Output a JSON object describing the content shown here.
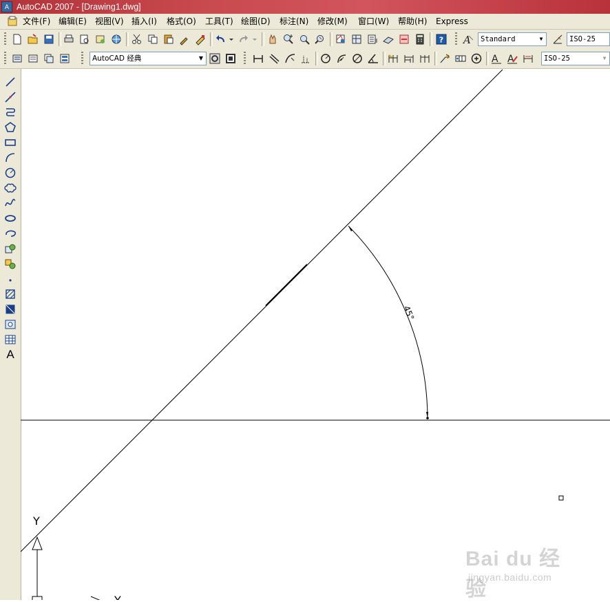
{
  "window": {
    "title": "AutoCAD 2007 - [Drawing1.dwg]",
    "app_icon_label": "A"
  },
  "menubar": {
    "items": [
      "文件(F)",
      "编辑(E)",
      "视图(V)",
      "插入(I)",
      "格式(O)",
      "工具(T)",
      "绘图(D)",
      "标注(N)",
      "修改(M)",
      "窗口(W)",
      "帮助(H)",
      "Express"
    ]
  },
  "toolbar1": {
    "text_style": "Standard",
    "dim_style": "ISO-25"
  },
  "toolbar2": {
    "workspace": "AutoCAD 经典",
    "dim_style": "ISO-25"
  },
  "left_toolbar": {
    "text_tool_label": "A"
  },
  "drawing": {
    "angle_dimension_text": "45°",
    "ucs_y_label": "Y",
    "ucs_x_label": "Y"
  },
  "watermark": {
    "line1": "Bai du 经验",
    "line2": "jingyan.baidu.com"
  },
  "colors": {
    "titlebar": "#c94a4f",
    "menubar_bg": "#ece9d8",
    "canvas_bg": "#ffffff",
    "line": "#000000"
  }
}
